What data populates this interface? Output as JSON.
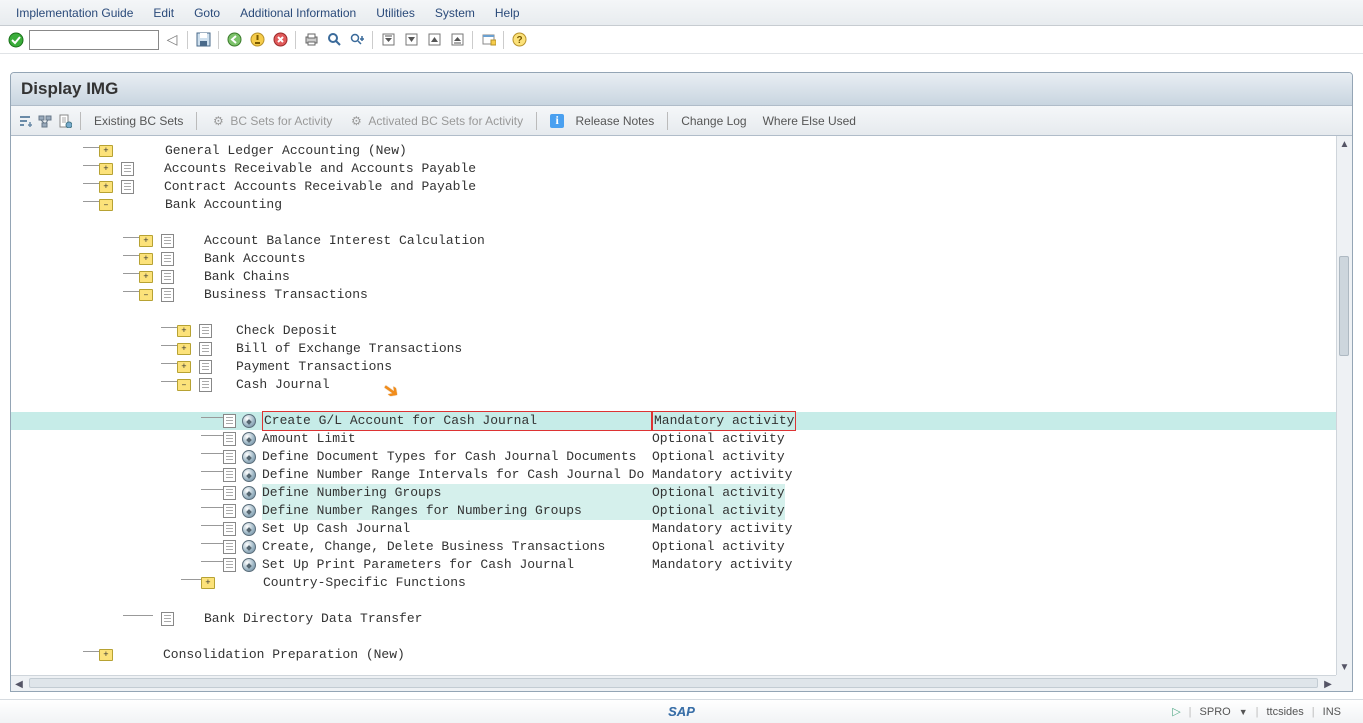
{
  "menu": [
    "Implementation Guide",
    "Edit",
    "Goto",
    "Additional Information",
    "Utilities",
    "System",
    "Help"
  ],
  "title": "Display IMG",
  "action_bar": {
    "existing_bc": "Existing BC Sets",
    "bc_activity": "BC Sets for Activity",
    "activated_bc": "Activated BC Sets for Activity",
    "release_notes": "Release Notes",
    "change_log": "Change Log",
    "where_else": "Where Else Used"
  },
  "activities": {
    "mandatory": "Mandatory activity",
    "optional": "Optional activity"
  },
  "tree": {
    "l1": [
      "General Ledger Accounting (New)",
      "Accounts Receivable and Accounts Payable",
      "Contract Accounts Receivable and Payable",
      "Bank Accounting"
    ],
    "l2": [
      "Account Balance Interest Calculation",
      "Bank Accounts",
      "Bank Chains",
      "Business Transactions"
    ],
    "l3": [
      "Check Deposit",
      "Bill of Exchange Transactions",
      "Payment Transactions",
      "Cash Journal"
    ],
    "l4": [
      "Create G/L Account for Cash Journal",
      "Amount Limit",
      "Define Document Types for Cash Journal Documents",
      "Define Number Range Intervals for Cash Journal Do",
      "Define Numbering Groups",
      "Define Number Ranges for Numbering Groups",
      "Set Up Cash Journal",
      "Create, Change, Delete Business Transactions",
      "Set Up Print Parameters for Cash Journal",
      "Country-Specific Functions"
    ],
    "bank_dir": "Bank Directory Data Transfer",
    "consol": "Consolidation Preparation (New)"
  },
  "status": {
    "tcode": "SPRO",
    "user": "ttcsides",
    "mode": "INS"
  }
}
